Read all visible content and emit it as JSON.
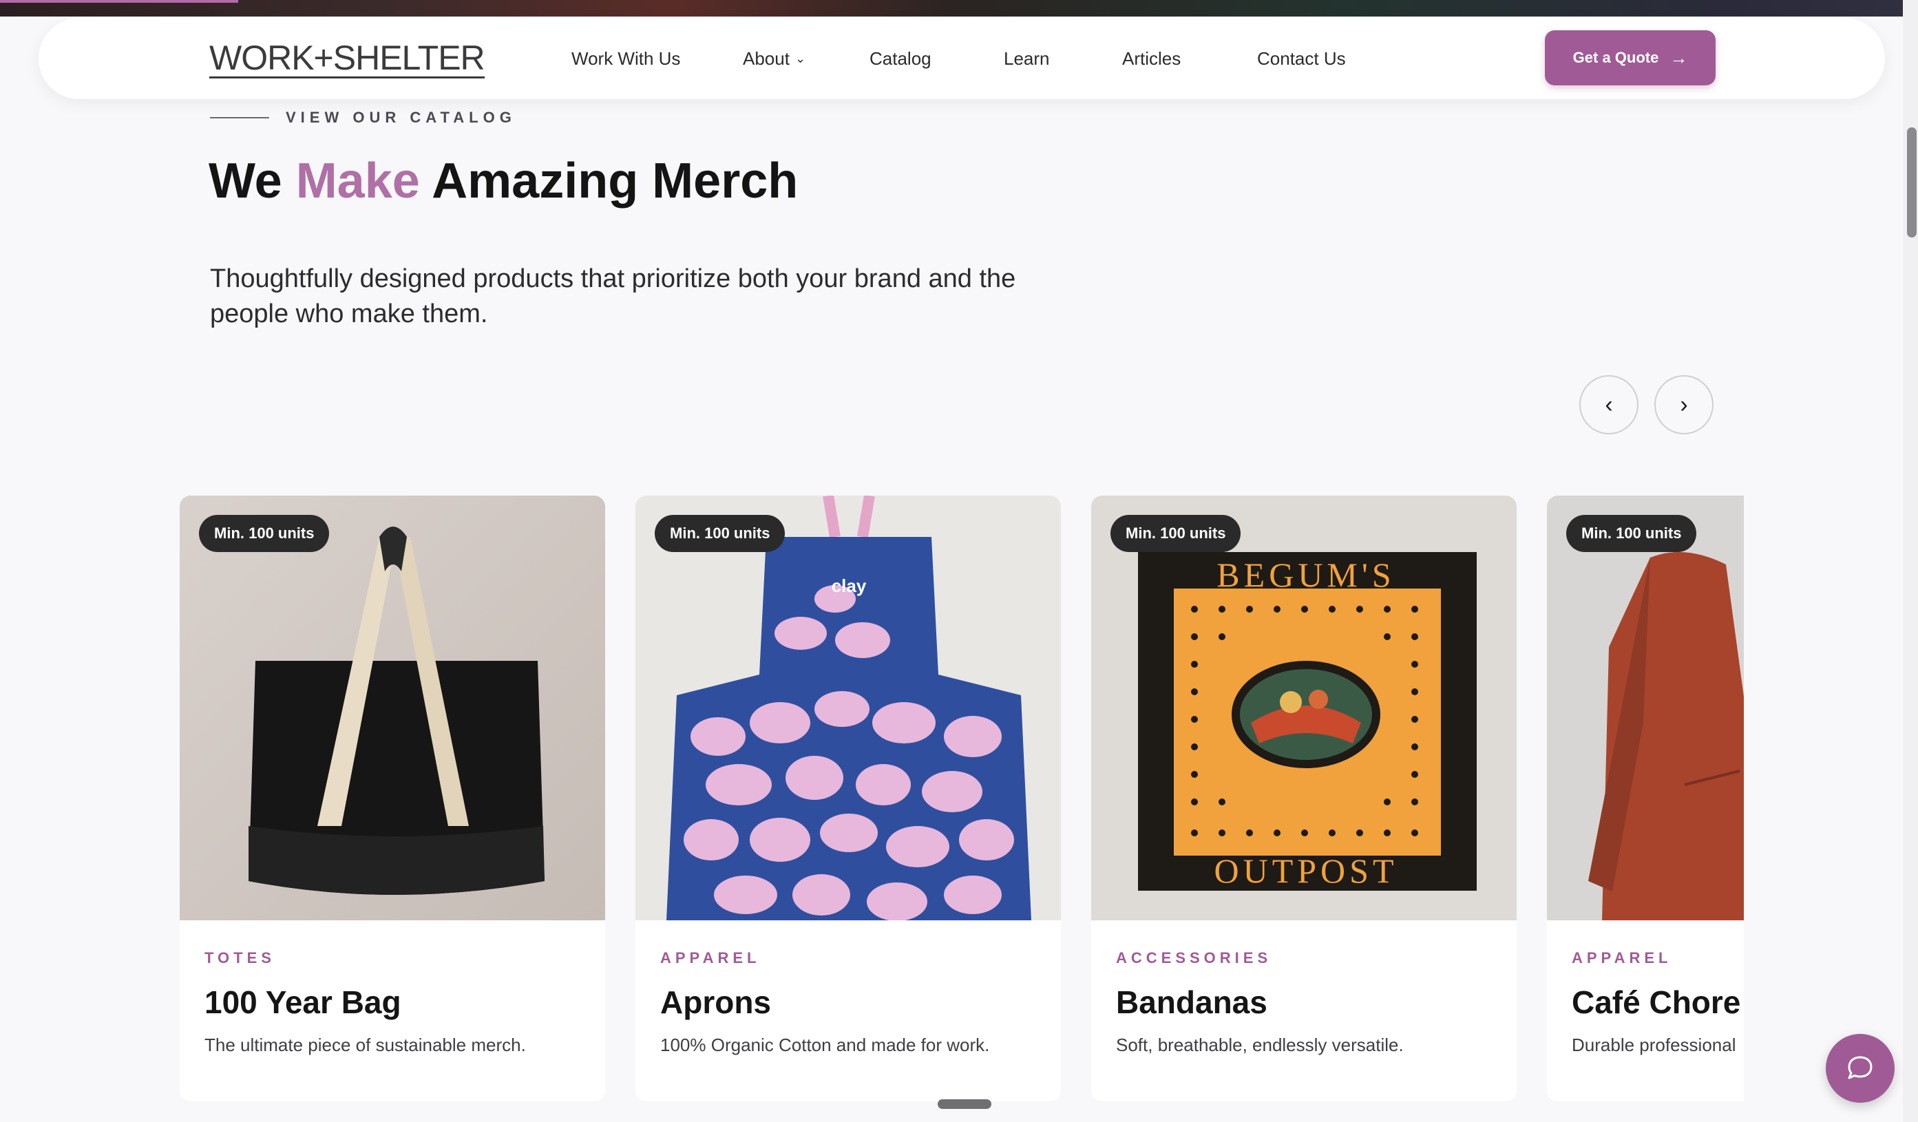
{
  "nav": {
    "logo": "WORK+SHELTER",
    "links": [
      "Work With Us",
      "About",
      "Catalog",
      "Learn",
      "Articles",
      "Contact Us"
    ],
    "cta": "Get a Quote"
  },
  "section": {
    "eyebrow": "VIEW OUR CATALOG",
    "headline_pre": "We ",
    "headline_accent": "Make",
    "headline_post": " Amazing Merch",
    "subtitle": "Thoughtfully designed products that prioritize both your brand and the people who make them."
  },
  "carousel": {
    "prev_icon": "chevron-left-icon",
    "next_icon": "chevron-right-icon"
  },
  "cards": [
    {
      "badge": "Min. 100 units",
      "category": "TOTES",
      "title": "100 Year Bag",
      "desc": "The ultimate piece of sustainable merch."
    },
    {
      "badge": "Min. 100 units",
      "category": "APPAREL",
      "title": "Aprons",
      "desc": "100% Organic Cotton and made for work.",
      "print": "clay"
    },
    {
      "badge": "Min. 100 units",
      "category": "ACCESSORIES",
      "title": "Bandanas",
      "desc": "Soft, breathable, endlessly versatile.",
      "print_top": "BEGUM'S",
      "print_bottom": "OUTPOST"
    },
    {
      "badge": "Min. 100 units",
      "category": "APPAREL",
      "title": "Café Chore Coat",
      "desc": "Durable professional"
    }
  ],
  "colors": {
    "accent": "#a05b96",
    "headline_accent": "#b06fa6",
    "background": "#f8f8fa"
  },
  "chat": {
    "icon": "chat-bubble-icon"
  }
}
